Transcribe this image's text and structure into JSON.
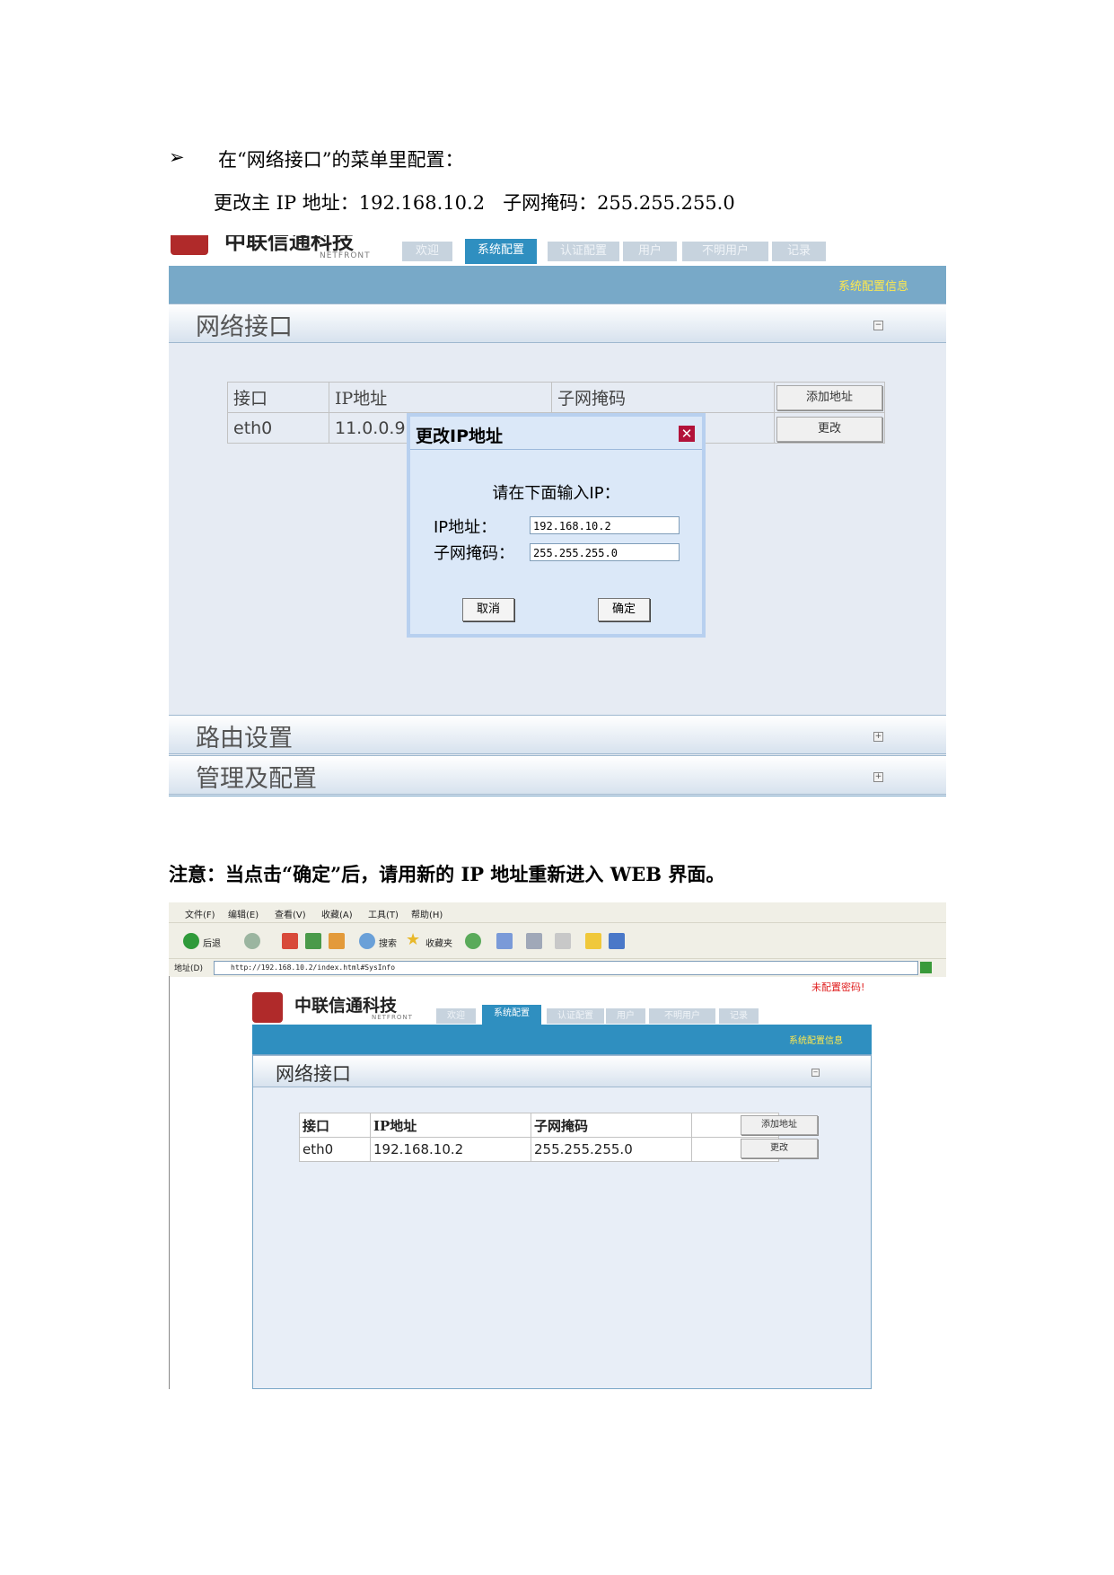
{
  "doc": {
    "bullet": "➢",
    "line1": "在“网络接口”的菜单里配置：",
    "line2": "更改主 IP 地址：192.168.10.2   子网掩码：255.255.255.0",
    "note": "注意：当点击“确定”后，请用新的 IP 地址重新进入 WEB 界面。"
  },
  "app": {
    "brand": "中联信通科技",
    "brand_sub": "NETFRONT",
    "tabs": [
      "欢迎",
      "系统配置",
      "认证配置",
      "用户",
      "不明用户",
      "记录"
    ],
    "active_tab": "系统配置",
    "info_link": "系统配置信息",
    "sections": {
      "network": "网络接口",
      "routing": "路由设置",
      "admin": "管理及配置"
    },
    "table_headers": [
      "接口",
      "IP地址",
      "子网掩码"
    ],
    "add_button": "添加地址",
    "change_button": "更改",
    "warning": "未配置密码!",
    "colors": {
      "accent": "#2f8fc0",
      "close": "#b2123a",
      "warning": "#e02020",
      "link": "#ffe94d"
    }
  },
  "shot1": {
    "row": {
      "interface": "eth0",
      "ip": "11.0.0.9"
    },
    "dialog": {
      "title": "更改IP地址",
      "prompt": "请在下面输入IP：",
      "ip_label": "IP地址：",
      "ip_value": "192.168.10.2",
      "mask_label": "子网掩码：",
      "mask_value": "255.255.255.0",
      "cancel": "取消",
      "ok": "确定"
    }
  },
  "shot2": {
    "menus": [
      "文件(F)",
      "编辑(E)",
      "查看(V)",
      "收藏(A)",
      "工具(T)",
      "帮助(H)"
    ],
    "toolbar": {
      "back": "后退",
      "search": "搜索",
      "favorites": "收藏夹"
    },
    "address_label": "地址(D)",
    "url": "http://192.168.10.2/index.html#SysInfo",
    "row": {
      "interface": "eth0",
      "ip": "192.168.10.2",
      "mask": "255.255.255.0"
    }
  }
}
